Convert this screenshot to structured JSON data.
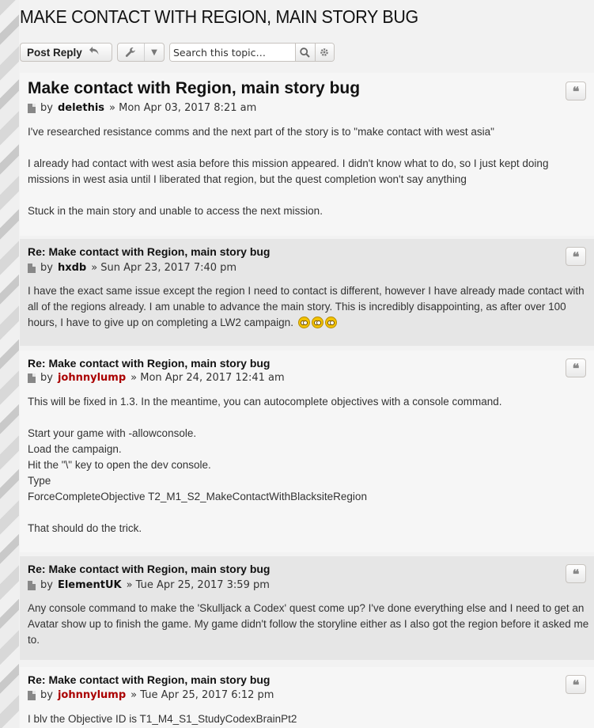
{
  "topic": {
    "title": "MAKE CONTACT WITH REGION, MAIN STORY BUG"
  },
  "toolbar": {
    "post_reply_label": "Post Reply",
    "reply_icon": "reply-arrow-icon",
    "tools_icon": "wrench-icon",
    "dropdown_icon": "caret-down-icon",
    "search_placeholder": "Search this topic…",
    "search_icon": "search-icon",
    "advanced_search_icon": "gear-icon"
  },
  "posts": [
    {
      "title": "Make contact with Region, main story bug",
      "by": "by",
      "author": "delethis",
      "date": "» Mon Apr 03, 2017 8:21 am",
      "paragraphs": [
        "I've researched resistance comms and the next part of the story is to \"make contact with west asia\"",
        "I already had contact with west asia before this mission appeared. I didn't know what to do, so I just kept doing missions in west asia until I liberated that region, but the quest completion won't say anything",
        "Stuck in the main story and unable to access the next mission."
      ]
    },
    {
      "title": "Re: Make contact with Region, main story bug",
      "by": "by",
      "author": "hxdb",
      "date": "» Sun Apr 23, 2017 7:40 pm",
      "paragraphs": [
        "I have the exact same issue except the region I need to contact is different, however I have already made contact with all of the regions already. I am unable to advance the main story. This is incredibly disappointing, as after over 100 hours, I have to give up on completing a LW2 campaign."
      ],
      "emoji_icon": "rolling-eyes-emoji-icon"
    },
    {
      "title": "Re: Make contact with Region, main story bug",
      "by": "by",
      "author": "johnnylump",
      "date": "» Mon Apr 24, 2017 12:41 am",
      "paragraphs": [
        "This will be fixed in 1.3. In the meantime, you can autocomplete objectives with a console command.",
        "Start your game with -allowconsole.\nLoad the campaign.\nHit the \"\\\" key to open the dev console.\nType\nForceCompleteObjective T2_M1_S2_MakeContactWithBlacksiteRegion",
        "That should do the trick."
      ]
    },
    {
      "title": "Re: Make contact with Region, main story bug",
      "by": "by",
      "author": "ElementUK",
      "date": "» Tue Apr 25, 2017 3:59 pm",
      "paragraphs": [
        "Any console command to make the 'Skulljack a Codex' quest come up? I've done everything else and I need to get an Avatar show up to finish the game. My game didn't follow the storyline either as I also got the region before it asked me to."
      ]
    },
    {
      "title": "Re: Make contact with Region, main story bug",
      "by": "by",
      "author": "johnnylump",
      "date": "» Tue Apr 25, 2017 6:12 pm",
      "paragraphs": [
        "I blv the Objective ID is T1_M4_S1_StudyCodexBrainPt2"
      ]
    }
  ],
  "quote_icon": "quote-icon",
  "post_icon": "post-file-icon"
}
